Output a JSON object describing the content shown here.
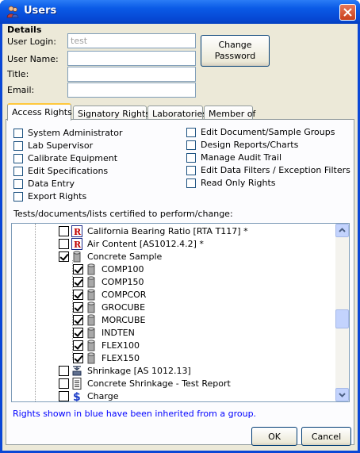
{
  "window": {
    "title": "Users"
  },
  "details": {
    "group_label": "Details",
    "user_login_label": "User Login:",
    "user_login_value": "test",
    "user_name_label": "User Name:",
    "user_name_value": "",
    "title_label": "Title:",
    "title_value": "",
    "email_label": "Email:",
    "email_value": "",
    "change_password_line1": "Change",
    "change_password_line2": "Password"
  },
  "tabs": [
    {
      "label": "Access Rights",
      "active": true
    },
    {
      "label": "Signatory Rights",
      "active": false
    },
    {
      "label": "Laboratories",
      "active": false
    },
    {
      "label": "Member of",
      "active": false
    }
  ],
  "rights_left": [
    "System Administrator",
    "Lab Supervisor",
    "Calibrate Equipment",
    "Edit Specifications",
    "Data Entry",
    "Export Rights"
  ],
  "rights_right": [
    "Edit Document/Sample Groups",
    "Design Reports/Charts",
    "Manage Audit Trail",
    "Edit Data Filters / Exception Filters",
    "Read Only Rights"
  ],
  "tree": {
    "label": "Tests/documents/lists certified to perform/change:",
    "items": [
      {
        "text": "California Bearing Ratio [RTA T117] *",
        "checked": false,
        "icon": "report-r-icon",
        "level": 0
      },
      {
        "text": "Air Content [AS1012.4.2] *",
        "checked": false,
        "icon": "report-r-icon",
        "level": 0
      },
      {
        "text": "Concrete Sample",
        "checked": true,
        "icon": "cylinder-icon",
        "level": 0
      },
      {
        "text": "COMP100",
        "checked": true,
        "icon": "cylinder-icon",
        "level": 1
      },
      {
        "text": "COMP150",
        "checked": true,
        "icon": "cylinder-icon",
        "level": 1
      },
      {
        "text": "COMPCOR",
        "checked": true,
        "icon": "cylinder-icon",
        "level": 1
      },
      {
        "text": "GROCUBE",
        "checked": true,
        "icon": "cylinder-icon",
        "level": 1
      },
      {
        "text": "MORCUBE",
        "checked": true,
        "icon": "cylinder-icon",
        "level": 1
      },
      {
        "text": "INDTEN",
        "checked": true,
        "icon": "cylinder-icon",
        "level": 1
      },
      {
        "text": "FLEX100",
        "checked": true,
        "icon": "cylinder-icon",
        "level": 1
      },
      {
        "text": "FLEX150",
        "checked": true,
        "icon": "cylinder-icon",
        "level": 1
      },
      {
        "text": "Shrinkage [AS 1012.13]",
        "checked": false,
        "icon": "shrinkage-icon",
        "level": 0
      },
      {
        "text": "Concrete Shrinkage - Test Report",
        "checked": false,
        "icon": "document-icon",
        "level": 0
      },
      {
        "text": "Charge",
        "checked": false,
        "icon": "dollar-icon",
        "level": 0
      }
    ]
  },
  "note": "Rights shown in blue have been inherited from a group.",
  "buttons": {
    "ok": "OK",
    "cancel": "Cancel"
  },
  "colors": {
    "titlebar": "#0a5ae6",
    "dialog_bg": "#ece9d8",
    "note_text": "#0000ff",
    "active_tab_accent": "#ffc83c"
  }
}
